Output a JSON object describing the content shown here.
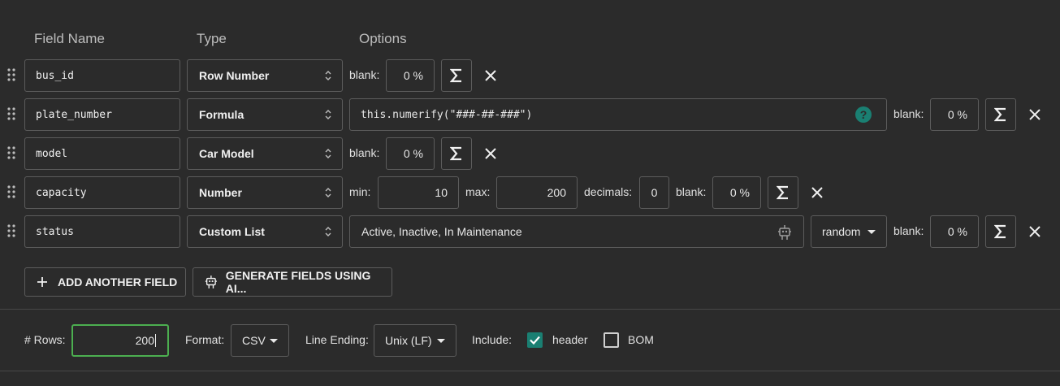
{
  "headers": {
    "field_name": "Field Name",
    "type": "Type",
    "options": "Options"
  },
  "rows": [
    {
      "name": "bus_id",
      "type": "Row Number",
      "blank_label": "blank:",
      "blank": "0 %"
    },
    {
      "name": "plate_number",
      "type": "Formula",
      "formula": "this.numerify(\"###-##-###\")",
      "blank_label": "blank:",
      "blank": "0 %"
    },
    {
      "name": "model",
      "type": "Car Model",
      "blank_label": "blank:",
      "blank": "0 %"
    },
    {
      "name": "capacity",
      "type": "Number",
      "min_label": "min:",
      "min": "10",
      "max_label": "max:",
      "max": "200",
      "decimals_label": "decimals:",
      "decimals": "0",
      "blank_label": "blank:",
      "blank": "0 %"
    },
    {
      "name": "status",
      "type": "Custom List",
      "values": "Active, Inactive, In Maintenance",
      "order": "random",
      "blank_label": "blank:",
      "blank": "0 %"
    }
  ],
  "actions": {
    "add_field": "ADD ANOTHER FIELD",
    "generate_ai": "GENERATE FIELDS USING AI..."
  },
  "footer": {
    "rows_label": "# Rows:",
    "rows_value": "200",
    "format_label": "Format:",
    "format_value": "CSV",
    "line_ending_label": "Line Ending:",
    "line_ending_value": "Unix (LF)",
    "include_label": "Include:",
    "header_label": "header",
    "header_checked": true,
    "bom_label": "BOM",
    "bom_checked": false
  },
  "colors": {
    "accent": "#1a7f72",
    "rows_border": "#4caf50",
    "help_icon": "#1a7f72"
  },
  "icons": [
    "drag-handle-icon",
    "updown-icon",
    "sigma-icon",
    "close-icon",
    "help-icon",
    "robot-icon",
    "plus-icon",
    "caret-down-icon",
    "checkbox-icon"
  ]
}
